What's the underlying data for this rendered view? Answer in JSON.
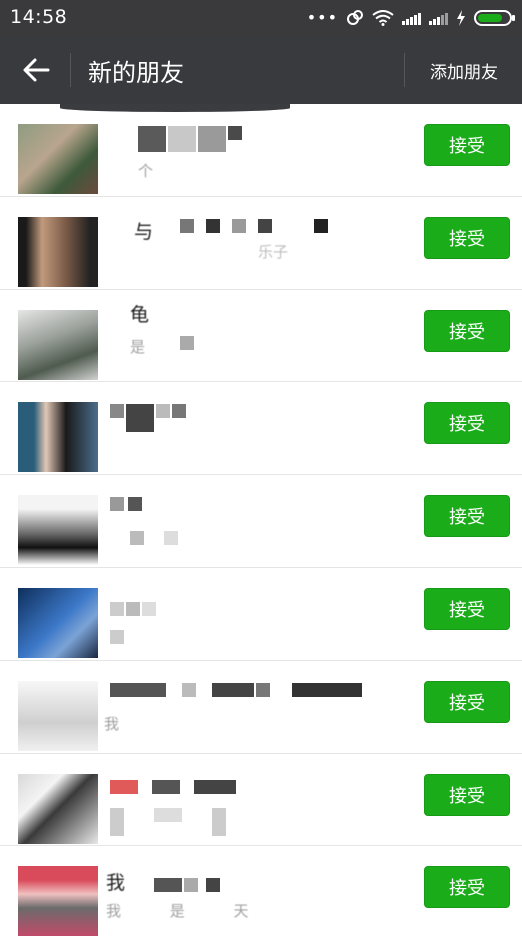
{
  "status_bar": {
    "time": "14:58",
    "icons": [
      "more-dots-icon",
      "hotspot-icon",
      "wifi-icon",
      "signal-icon",
      "signal-icon",
      "charging-icon",
      "battery-icon"
    ],
    "battery_color": "#1aad19"
  },
  "nav": {
    "title": "新的朋友",
    "action_label": "添加朋友",
    "background": "#393a3e"
  },
  "requests": [
    {
      "name": "",
      "message": "个",
      "accept_label": "接受"
    },
    {
      "name": "与",
      "message": "乐子",
      "accept_label": "接受"
    },
    {
      "name": "龟",
      "message": "是",
      "accept_label": "接受"
    },
    {
      "name": "",
      "message": "",
      "accept_label": "接受"
    },
    {
      "name": "",
      "message": "",
      "accept_label": "接受"
    },
    {
      "name": "",
      "message": "",
      "accept_label": "接受"
    },
    {
      "name": "",
      "message": "我",
      "accept_label": "接受"
    },
    {
      "name": "",
      "message": "",
      "accept_label": "接受"
    },
    {
      "name": "我",
      "message": "我 是 天",
      "accept_label": "接受"
    }
  ],
  "accent_color": "#1aad19"
}
